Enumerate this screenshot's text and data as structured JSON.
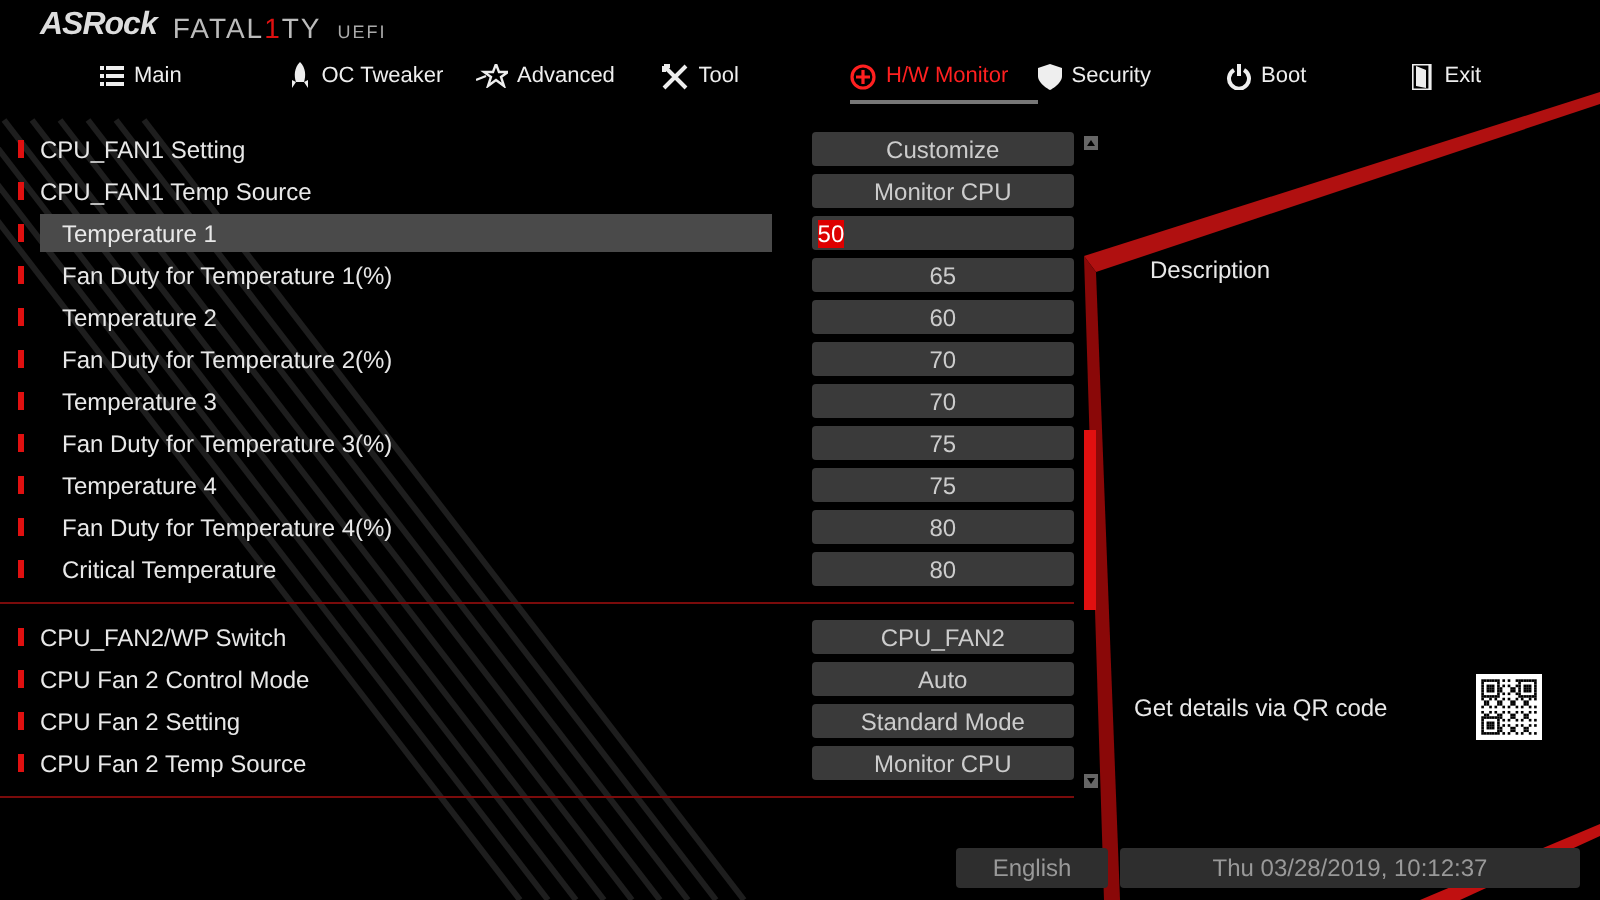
{
  "logo": {
    "brand": "ASRock",
    "product_parts": [
      {
        "text": "FATAL",
        "accent": false
      },
      {
        "text": "1",
        "accent": true
      },
      {
        "text": "TY",
        "accent": false
      }
    ],
    "suffix": "UEFI"
  },
  "tabs": [
    {
      "label": "Main",
      "selected": false
    },
    {
      "label": "OC Tweaker",
      "selected": false
    },
    {
      "label": "Advanced",
      "selected": false
    },
    {
      "label": "Tool",
      "selected": false
    },
    {
      "label": "H/W Monitor",
      "selected": true
    },
    {
      "label": "Security",
      "selected": false
    },
    {
      "label": "Boot",
      "selected": false
    },
    {
      "label": "Exit",
      "selected": false
    }
  ],
  "groups": [
    {
      "items": [
        {
          "label": "CPU_FAN1 Setting",
          "value": "Customize",
          "kind": "option",
          "sub": false,
          "selected": false
        },
        {
          "label": "CPU_FAN1 Temp Source",
          "value": "Monitor CPU",
          "kind": "option",
          "sub": false,
          "selected": false
        },
        {
          "label": "Temperature 1",
          "value": "50",
          "kind": "input",
          "sub": true,
          "selected": true
        },
        {
          "label": "Fan Duty for Temperature 1(%)",
          "value": "65",
          "kind": "option",
          "sub": true,
          "selected": false
        },
        {
          "label": "Temperature 2",
          "value": "60",
          "kind": "option",
          "sub": true,
          "selected": false
        },
        {
          "label": "Fan Duty for Temperature 2(%)",
          "value": "70",
          "kind": "option",
          "sub": true,
          "selected": false
        },
        {
          "label": "Temperature 3",
          "value": "70",
          "kind": "option",
          "sub": true,
          "selected": false
        },
        {
          "label": "Fan Duty for Temperature 3(%)",
          "value": "75",
          "kind": "option",
          "sub": true,
          "selected": false
        },
        {
          "label": "Temperature 4",
          "value": "75",
          "kind": "option",
          "sub": true,
          "selected": false
        },
        {
          "label": "Fan Duty for Temperature 4(%)",
          "value": "80",
          "kind": "option",
          "sub": true,
          "selected": false
        },
        {
          "label": "Critical Temperature",
          "value": "80",
          "kind": "option",
          "sub": true,
          "selected": false
        }
      ]
    },
    {
      "items": [
        {
          "label": "CPU_FAN2/WP Switch",
          "value": "CPU_FAN2",
          "kind": "option",
          "sub": false,
          "selected": false
        },
        {
          "label": "CPU Fan 2 Control Mode",
          "value": "Auto",
          "kind": "option",
          "sub": false,
          "selected": false
        },
        {
          "label": "CPU Fan 2 Setting",
          "value": "Standard Mode",
          "kind": "option",
          "sub": false,
          "selected": false
        },
        {
          "label": "CPU Fan 2 Temp Source",
          "value": "Monitor CPU",
          "kind": "option",
          "sub": false,
          "selected": false
        }
      ]
    }
  ],
  "description": {
    "title": "Description",
    "qr_hint": "Get details via QR code"
  },
  "status_bar": {
    "language": "English",
    "datetime": "Thu 03/28/2019, 10:12:37"
  }
}
